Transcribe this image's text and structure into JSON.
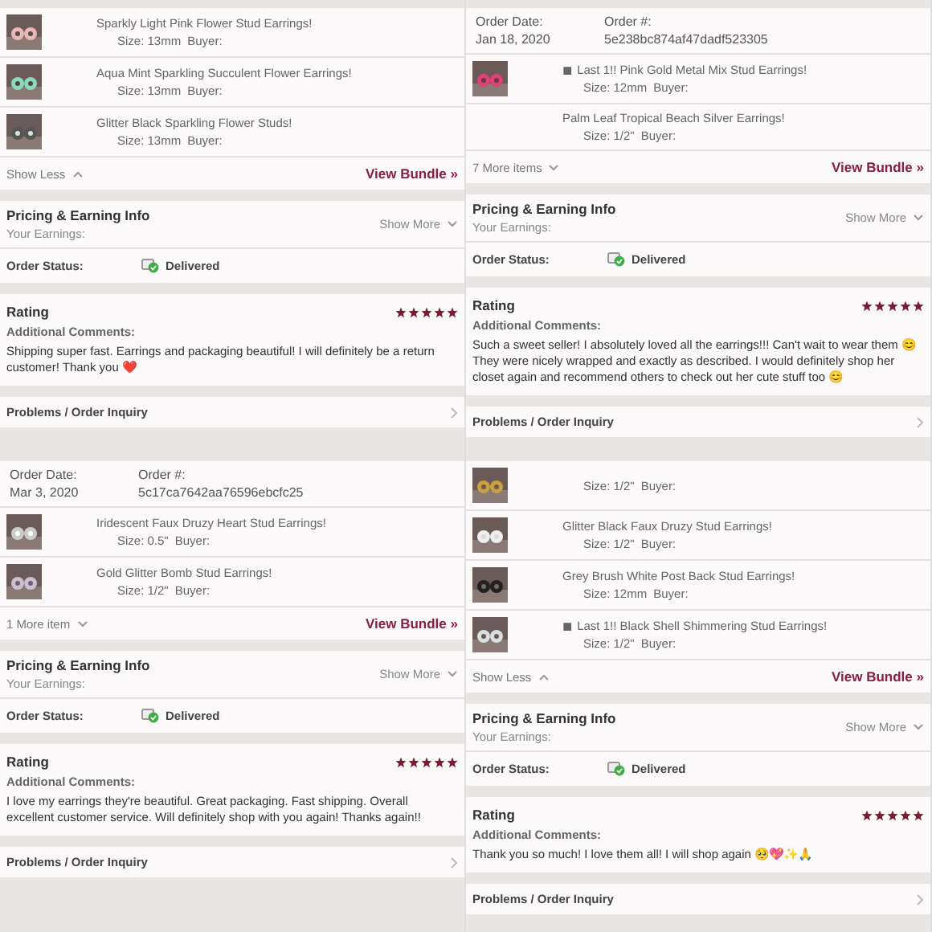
{
  "panels": [
    {
      "items": [
        {
          "title": "Sparkly Light Pink Flower Stud Earrings!",
          "size": "Size: 13mm",
          "buyer_label": "Buyer:",
          "thumbnail": true
        },
        {
          "title": "Aqua Mint Sparkling Succulent Flower Earrings!",
          "size": "Size: 13mm",
          "buyer_label": "Buyer:",
          "thumbnail": true
        },
        {
          "title": "Glitter Black Sparkling Flower Studs!",
          "size": "Size: 13mm",
          "buyer_label": "Buyer:",
          "thumbnail": true
        }
      ],
      "footer": {
        "toggle": "Show Less",
        "expanded": true,
        "link": "View Bundle »"
      },
      "pricing": {
        "title": "Pricing & Earning Info",
        "earnings_label": "Your Earnings:",
        "toggle": "Show More"
      },
      "status": {
        "label": "Order Status:",
        "value": "Delivered"
      },
      "rating": {
        "title": "Rating",
        "stars": 5,
        "comments_label": "Additional Comments:",
        "comment": "Shipping super fast. Earrings and packaging beautiful! I will definitely be a return customer! Thank you ❤️"
      },
      "inquiry": "Problems / Order Inquiry"
    },
    {
      "order": {
        "date_label": "Order Date:",
        "date": "Jan 18, 2020",
        "number_label": "Order #:",
        "number": "5e238bc874af47dadf523305"
      },
      "items": [
        {
          "title": "◼ Last 1!! Pink Gold Metal Mix Stud Earrings!",
          "size": "Size: 12mm",
          "buyer_label": "Buyer:",
          "thumbnail": true
        },
        {
          "title": "Palm Leaf Tropical Beach Silver Earrings!",
          "size": "Size: 1/2\"",
          "buyer_label": "Buyer:",
          "thumbnail": false
        }
      ],
      "footer": {
        "toggle": "7 More items",
        "expanded": false,
        "link": "View Bundle »"
      },
      "pricing": {
        "title": "Pricing & Earning Info",
        "earnings_label": "Your Earnings:",
        "toggle": "Show More"
      },
      "status": {
        "label": "Order Status:",
        "value": "Delivered"
      },
      "rating": {
        "title": "Rating",
        "stars": 5,
        "comments_label": "Additional Comments:",
        "comment": "Such a sweet seller! I absolutely loved all the earrings!!! Can't wait to wear them 😊 They were nicely wrapped and exactly as described. I would definitely shop her closet again and recommend others to check out her cute stuff too 😊"
      },
      "inquiry": "Problems / Order Inquiry"
    },
    {
      "order": {
        "date_label": "Order Date:",
        "date": "Mar 3, 2020",
        "number_label": "Order #:",
        "number": "5c17ca7642aa76596ebcfc25"
      },
      "items": [
        {
          "title": "Iridescent Faux Druzy Heart Stud Earrings!",
          "size": "Size: 0.5\"",
          "buyer_label": "Buyer:",
          "thumbnail": true
        },
        {
          "title": "Gold Glitter Bomb Stud Earrings!",
          "size": "Size: 1/2\"",
          "buyer_label": "Buyer:",
          "thumbnail": true
        }
      ],
      "footer": {
        "toggle": "1 More item",
        "expanded": false,
        "link": "View Bundle »"
      },
      "pricing": {
        "title": "Pricing & Earning Info",
        "earnings_label": "Your Earnings:",
        "toggle": "Show More"
      },
      "status": {
        "label": "Order Status:",
        "value": "Delivered"
      },
      "rating": {
        "title": "Rating",
        "stars": 5,
        "comments_label": "Additional Comments:",
        "comment": "I love my earrings they're beautiful. Great packaging. Fast shipping. Overall excellent customer service. Will definitely shop with you again! Thanks again!!"
      },
      "inquiry": "Problems / Order Inquiry"
    },
    {
      "items": [
        {
          "size": "Size: 1/2\"",
          "buyer_label": "Buyer:",
          "thumbnail": true
        },
        {
          "title": "Glitter Black Faux Druzy Stud Earrings!",
          "size": "Size: 1/2\"",
          "buyer_label": "Buyer:",
          "thumbnail": true
        },
        {
          "title": "Grey Brush White Post Back Stud Earrings!",
          "size": "Size: 12mm",
          "buyer_label": "Buyer:",
          "thumbnail": true
        },
        {
          "title": "◼ Last 1!! Black Shell Shimmering Stud Earrings!",
          "size": "Size: 1/2\"",
          "buyer_label": "Buyer:",
          "thumbnail": true
        }
      ],
      "footer": {
        "toggle": "Show Less",
        "expanded": true,
        "link": "View Bundle »"
      },
      "pricing": {
        "title": "Pricing & Earning Info",
        "earnings_label": "Your Earnings:",
        "toggle": "Show More"
      },
      "status": {
        "label": "Order Status:",
        "value": "Delivered"
      },
      "rating": {
        "title": "Rating",
        "stars": 5,
        "comments_label": "Additional Comments:",
        "comment": "Thank you so much! I love them all! I will shop again 🥺💖✨🙏"
      },
      "inquiry": "Problems / Order Inquiry"
    }
  ]
}
